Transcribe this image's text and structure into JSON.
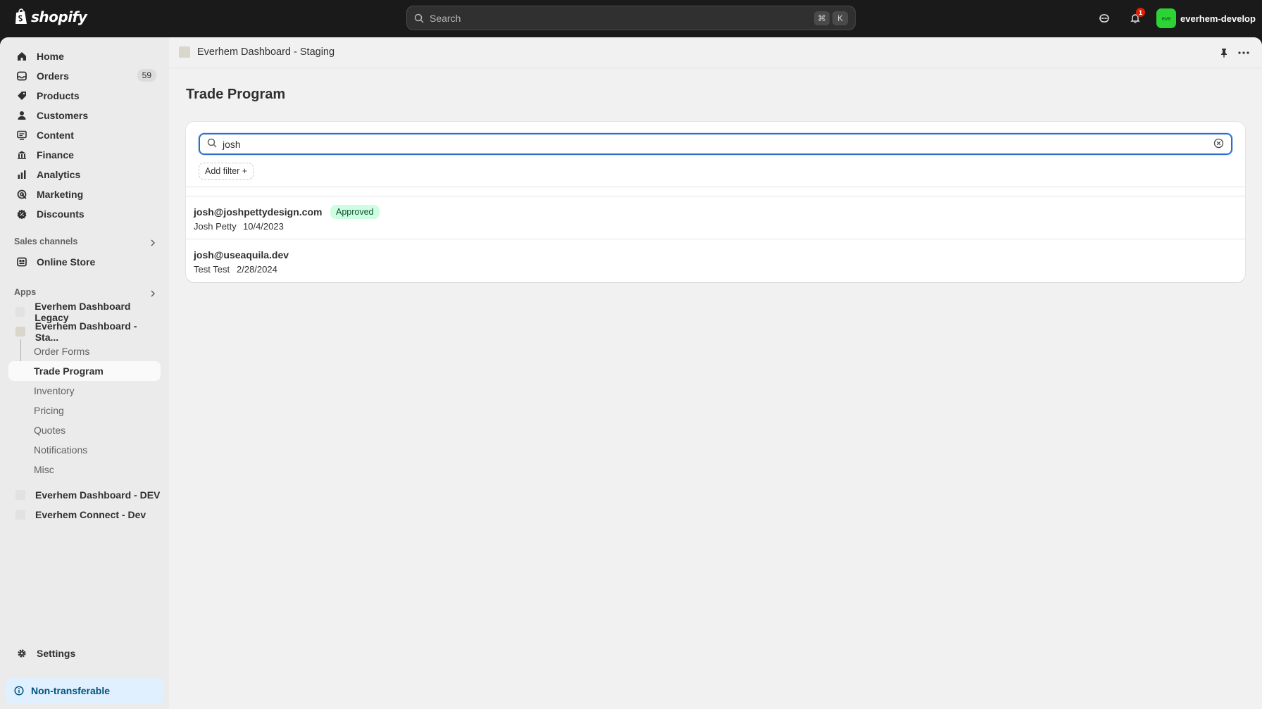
{
  "topbar": {
    "logo_text": "shopify",
    "search_placeholder": "Search",
    "shortcut_keys": [
      "⌘",
      "K"
    ],
    "notification_count": "1",
    "store_avatar": "eve",
    "store_name": "everhem-develop"
  },
  "sidebar": {
    "main_items": [
      {
        "label": "Home",
        "icon": "home-icon"
      },
      {
        "label": "Orders",
        "icon": "orders-icon",
        "badge": "59"
      },
      {
        "label": "Products",
        "icon": "tag-icon"
      },
      {
        "label": "Customers",
        "icon": "person-icon"
      },
      {
        "label": "Content",
        "icon": "content-icon"
      },
      {
        "label": "Finance",
        "icon": "bank-icon"
      },
      {
        "label": "Analytics",
        "icon": "bar-chart-icon"
      },
      {
        "label": "Marketing",
        "icon": "target-icon"
      },
      {
        "label": "Discounts",
        "icon": "discount-icon"
      }
    ],
    "sales_channels_label": "Sales channels",
    "sales_channels": [
      {
        "label": "Online Store",
        "icon": "store-icon"
      }
    ],
    "apps_label": "Apps",
    "apps": [
      {
        "label": "Everhem Dashboard Legacy"
      },
      {
        "label": "Everhem Dashboard - Sta..."
      }
    ],
    "app_subitems": [
      {
        "label": "Order Forms",
        "active": false
      },
      {
        "label": "Trade Program",
        "active": true
      },
      {
        "label": "Inventory",
        "active": false
      },
      {
        "label": "Pricing",
        "active": false
      },
      {
        "label": "Quotes",
        "active": false
      },
      {
        "label": "Notifications",
        "active": false
      },
      {
        "label": "Misc",
        "active": false
      }
    ],
    "more_apps": [
      {
        "label": "Everhem Dashboard - DEV"
      },
      {
        "label": "Everhem Connect - Dev"
      }
    ],
    "settings_label": "Settings",
    "non_transferable_label": "Non-transferable"
  },
  "main": {
    "app_title": "Everhem Dashboard - Staging",
    "page_title": "Trade Program",
    "search_value": "josh",
    "add_filter_label": "Add filter +",
    "results": [
      {
        "email": "josh@joshpettydesign.com",
        "status": "Approved",
        "name": "Josh Petty",
        "date": "10/4/2023"
      },
      {
        "email": "josh@useaquila.dev",
        "status": "",
        "name": "Test Test",
        "date": "2/28/2024"
      }
    ]
  },
  "colors": {
    "topbar_bg": "#1a1a1a",
    "accent_focus": "#2c6ecb",
    "approved_badge_bg": "#cdfee1",
    "approved_badge_text": "#0c5132",
    "store_avatar_bg": "#2cd334"
  }
}
